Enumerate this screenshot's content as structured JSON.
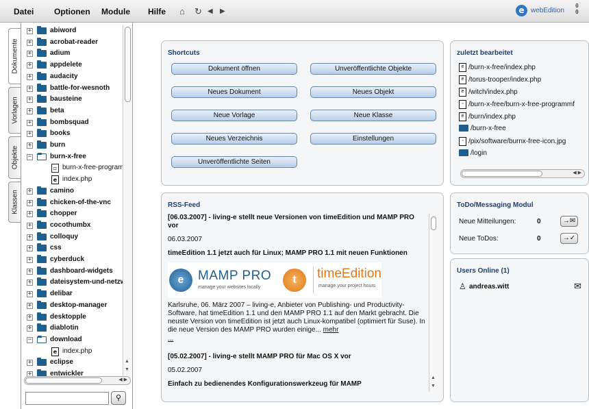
{
  "menubar": {
    "items": [
      "Datei",
      "Optionen",
      "Module",
      "Hilfe"
    ],
    "toolbar_icons": [
      "home-icon",
      "refresh-icon",
      "back-icon",
      "forward-icon"
    ],
    "brand": "webEdition",
    "counter_top": "0",
    "counter_bottom": "0"
  },
  "tabs": [
    "Dokumente",
    "Vorlagen",
    "Objekte",
    "Klassen"
  ],
  "tree": [
    {
      "label": "abiword",
      "type": "folder",
      "expanded": false,
      "depth": 0
    },
    {
      "label": "acrobat-reader",
      "type": "folder",
      "expanded": false,
      "depth": 0
    },
    {
      "label": "adium",
      "type": "folder",
      "expanded": false,
      "depth": 0
    },
    {
      "label": "appdelete",
      "type": "folder",
      "expanded": false,
      "depth": 0
    },
    {
      "label": "audacity",
      "type": "folder",
      "expanded": false,
      "depth": 0
    },
    {
      "label": "battle-for-wesnoth",
      "type": "folder",
      "expanded": false,
      "depth": 0
    },
    {
      "label": "bausteine",
      "type": "folder",
      "expanded": false,
      "depth": 0
    },
    {
      "label": "beta",
      "type": "folder",
      "expanded": false,
      "depth": 0
    },
    {
      "label": "bombsquad",
      "type": "folder",
      "expanded": false,
      "depth": 0
    },
    {
      "label": "books",
      "type": "folder",
      "expanded": false,
      "depth": 0
    },
    {
      "label": "burn",
      "type": "folder",
      "expanded": false,
      "depth": 0
    },
    {
      "label": "burn-x-free",
      "type": "folder",
      "expanded": true,
      "depth": 0
    },
    {
      "label": "burn-x-free-programr",
      "type": "image",
      "depth": 1
    },
    {
      "label": "index.php",
      "type": "php",
      "depth": 1
    },
    {
      "label": "camino",
      "type": "folder",
      "expanded": false,
      "depth": 0
    },
    {
      "label": "chicken-of-the-vnc",
      "type": "folder",
      "expanded": false,
      "depth": 0
    },
    {
      "label": "chopper",
      "type": "folder",
      "expanded": false,
      "depth": 0
    },
    {
      "label": "cocothumbx",
      "type": "folder",
      "expanded": false,
      "depth": 0
    },
    {
      "label": "colloquy",
      "type": "folder",
      "expanded": false,
      "depth": 0
    },
    {
      "label": "css",
      "type": "folder",
      "expanded": false,
      "depth": 0
    },
    {
      "label": "cyberduck",
      "type": "folder",
      "expanded": false,
      "depth": 0
    },
    {
      "label": "dashboard-widgets",
      "type": "folder",
      "expanded": false,
      "depth": 0
    },
    {
      "label": "dateisystem-und-netzw",
      "type": "folder",
      "expanded": false,
      "depth": 0
    },
    {
      "label": "delibar",
      "type": "folder",
      "expanded": false,
      "depth": 0
    },
    {
      "label": "desktop-manager",
      "type": "folder",
      "expanded": false,
      "depth": 0
    },
    {
      "label": "desktopple",
      "type": "folder",
      "expanded": false,
      "depth": 0
    },
    {
      "label": "diablotin",
      "type": "folder",
      "expanded": false,
      "depth": 0
    },
    {
      "label": "download",
      "type": "folder",
      "expanded": true,
      "depth": 0
    },
    {
      "label": "index.php",
      "type": "php",
      "depth": 1
    },
    {
      "label": "eclipse",
      "type": "folder",
      "expanded": false,
      "depth": 0
    },
    {
      "label": "entwickler",
      "type": "folder",
      "expanded": false,
      "depth": 0
    }
  ],
  "search": {
    "value": "",
    "placeholder": ""
  },
  "shortcuts": {
    "title": "Shortcuts",
    "buttons": [
      "Dokument öffnen",
      "Unveröffentlichte Objekte",
      "Neues Dokument",
      "Neues Objekt",
      "Neue Vorlage",
      "Neue Klasse",
      "Neues Verzeichnis",
      "Einstellungen",
      "Unveröffentlichte Seiten"
    ]
  },
  "recent": {
    "title": "zuletzt bearbeitet",
    "items": [
      {
        "label": "/burn-x-free/index.php",
        "type": "php"
      },
      {
        "label": "/torus-trooper/index.php",
        "type": "php"
      },
      {
        "label": "/witch/index.php",
        "type": "php"
      },
      {
        "label": "/burn-x-free/burn-x-free-programmf",
        "type": "image"
      },
      {
        "label": "/burn/index.php",
        "type": "php"
      },
      {
        "label": "/burn-x-free",
        "type": "folder"
      },
      {
        "label": "/pix/software/burnx-free-icon.jpg",
        "type": "image"
      },
      {
        "label": "/login",
        "type": "folder"
      }
    ]
  },
  "rss": {
    "title": "RSS-Feed",
    "item1_title": "[06.03.2007] - living-e stellt neue Versionen von timeEdition und MAMP PRO vor",
    "item1_date": "06.03.2007",
    "item1_subtitle": "timeEdition 1.1 jetzt auch für Linux; MAMP PRO 1.1 mit neuen Funktionen",
    "banner_mamp": "MAMP PRO",
    "banner_mamp_sub": "manage your websites locally",
    "banner_te": "timeEdition",
    "banner_te_sub": "manage your project hours",
    "item1_body": "Karlsruhe, 06. März 2007 – living-e, Anbieter von Publishing- und Productivity-Software, hat timeEdition 1.1 und den MAMP PRO 1.1 auf den Markt gebracht. Die neuste Version von timeEdition ist jetzt auch Linux-kompatibel (optimiert für Suse). In die neue Version des MAMP PRO wurden einige...",
    "item1_more": "mehr",
    "item1_ellipsis": "...",
    "item2_title": "[05.02.2007] - living-e stellt MAMP PRO für Mac OS X vor",
    "item2_date": "05.02.2007",
    "item2_subtitle": "Einfach zu bedienendes Konfigurationswerkzeug für MAMP"
  },
  "todo": {
    "title": "ToDo/Messaging Modul",
    "messages_label": "Neue Mitteilungen:",
    "messages_count": "0",
    "todos_label": "Neue ToDos:",
    "todos_count": "0"
  },
  "users": {
    "title": "Users Online (1)",
    "user": "andreas.witt"
  },
  "colors": {
    "accent": "#1f3f6e",
    "folder": "#1f5f8e",
    "button": "#b8cde8"
  }
}
